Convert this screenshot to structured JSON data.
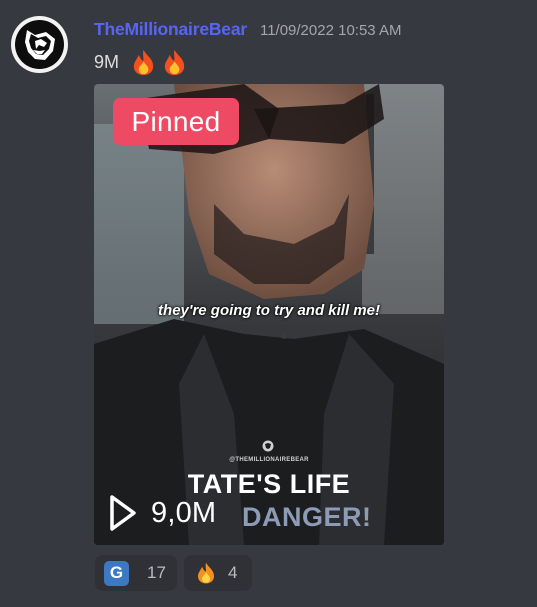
{
  "message": {
    "username": "TheMillionaireBear",
    "timestamp": "11/09/2022 10:53 AM",
    "text": "9M",
    "emojis": [
      "fire-emoji",
      "fire-emoji"
    ]
  },
  "media": {
    "badge": "Pinned",
    "caption": "they're going to try and kill me!",
    "watermark": "@THEMILLIONAIREBEAR",
    "title_line1": "TATE'S LIFE",
    "title_line2": "DANGER!",
    "views": "9,0M",
    "play_icon": "play-icon"
  },
  "reactions": [
    {
      "emoji": "G",
      "icon": "g-letter-icon",
      "count": "17"
    },
    {
      "emoji": "fire",
      "icon": "fire-icon",
      "count": "4"
    }
  ],
  "colors": {
    "background": "#36393f",
    "username": "#5865f2",
    "badge": "#ef4a63",
    "reaction_bg": "#2f3136"
  }
}
